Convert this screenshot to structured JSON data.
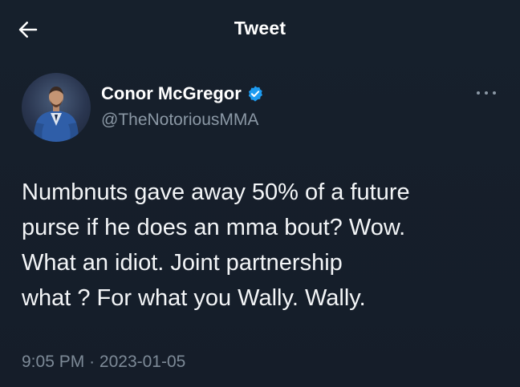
{
  "header": {
    "title": "Tweet",
    "back_icon": "arrow-left-icon"
  },
  "author": {
    "name": "Conor McGregor",
    "handle": "@TheNotoriousMMA",
    "verified": true,
    "verified_color": "#1d9bf0"
  },
  "tweet": {
    "lines": [
      "Numbnuts gave away 50% of a future",
      "purse if he does an mma bout? Wow.",
      "What an idiot. Joint partnership",
      "what ? For what you Wally. Wally."
    ],
    "time": "9:05 PM",
    "separator": "·",
    "date": "2023-01-05"
  },
  "colors": {
    "background": "#15202b",
    "text": "#ffffff",
    "secondary_text": "#8b98a5"
  }
}
